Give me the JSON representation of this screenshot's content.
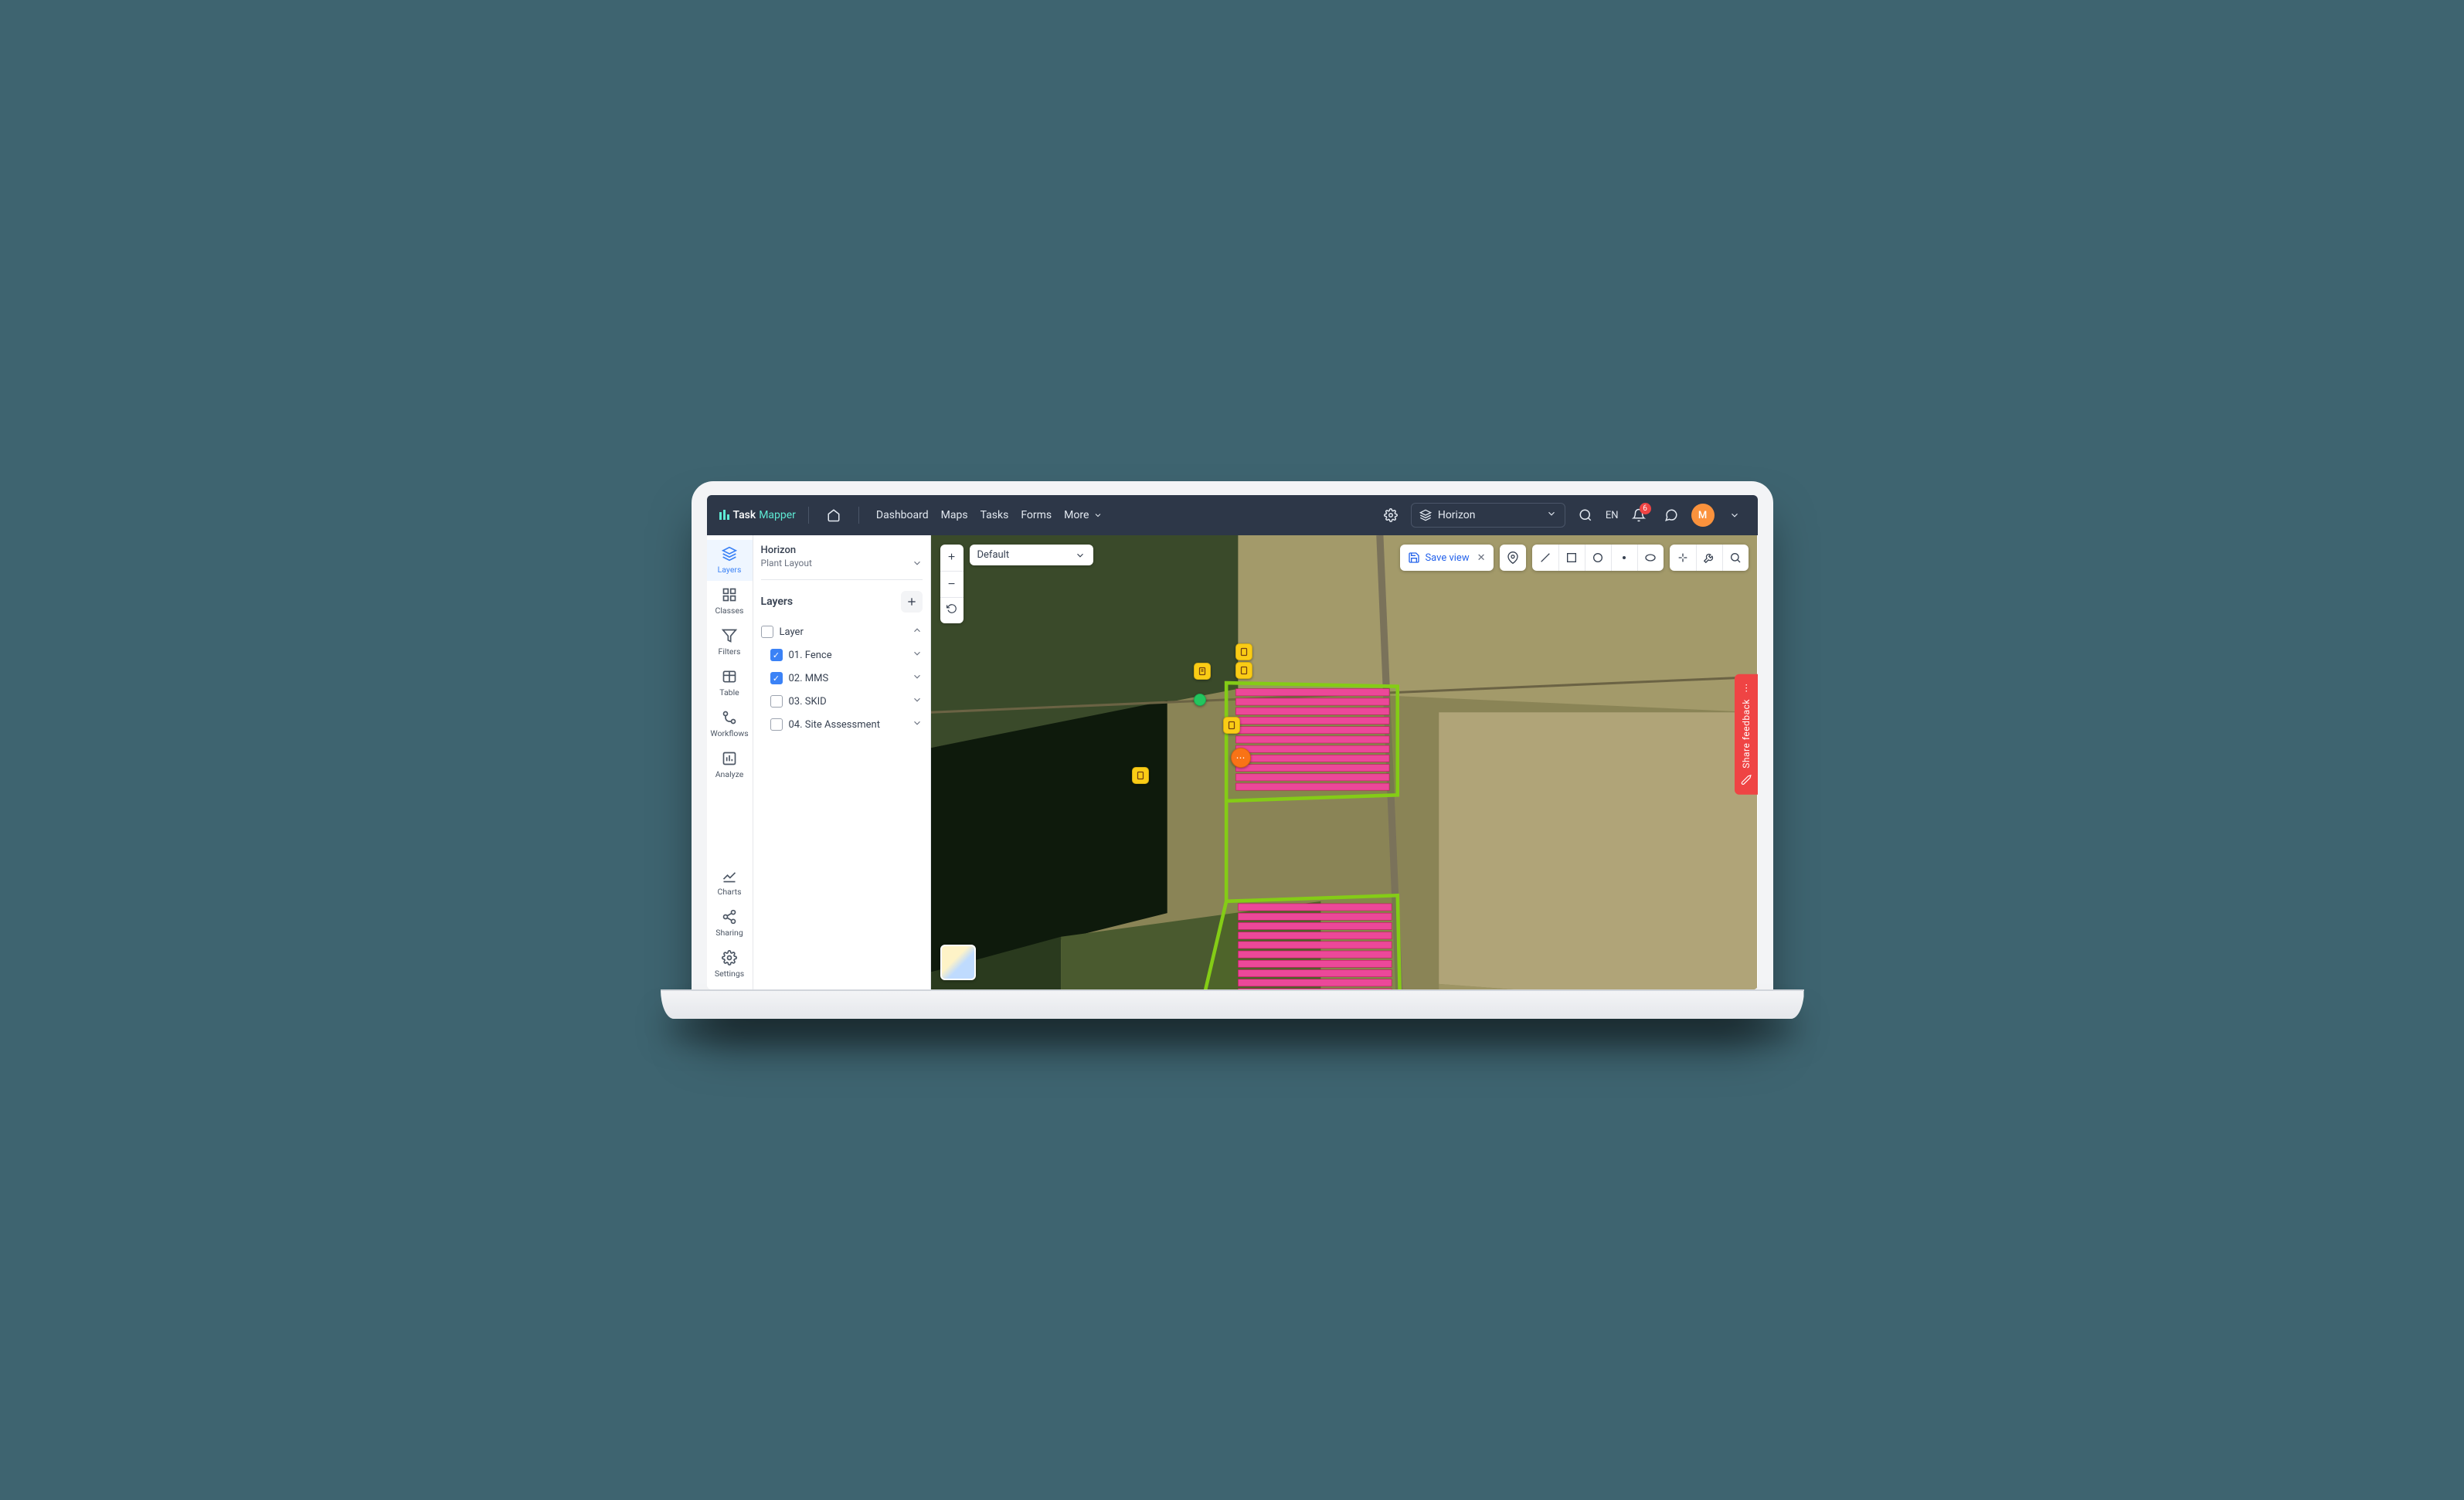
{
  "brand": {
    "prefix": "Task",
    "suffix": "Mapper"
  },
  "nav": {
    "dashboard": "Dashboard",
    "maps": "Maps",
    "tasks": "Tasks",
    "forms": "Forms",
    "more": "More"
  },
  "header": {
    "asset_selected": "Horizon",
    "language": "EN",
    "notifications_count": "6",
    "avatar_initial": "M"
  },
  "sidebar": {
    "layers": "Layers",
    "classes": "Classes",
    "filters": "Filters",
    "table": "Table",
    "workflows": "Workflows",
    "analyze": "Analyze",
    "charts": "Charts",
    "sharing": "Sharing",
    "settings": "Settings"
  },
  "panel": {
    "title": "Horizon",
    "subtitle": "Plant Layout",
    "section": "Layers",
    "root": "Layer",
    "items": [
      {
        "label": "01. Fence",
        "checked": true
      },
      {
        "label": "02. MMS",
        "checked": true
      },
      {
        "label": "03. SKID",
        "checked": false
      },
      {
        "label": "04. Site Assessment",
        "checked": false
      }
    ]
  },
  "map": {
    "view_dropdown": "Default",
    "save_view": "Save view",
    "feedback": "Share feedback"
  },
  "colors": {
    "accent": "#3b82f6",
    "danger": "#ef4444",
    "marker_yellow": "#facc15",
    "marker_orange": "#fb923c",
    "marker_green": "#22c55e",
    "solar_fill": "#ec4899",
    "site_outline": "#65a30d"
  }
}
